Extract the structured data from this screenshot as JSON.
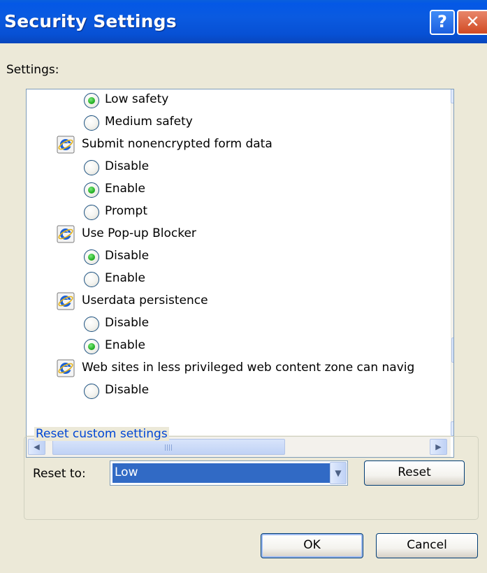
{
  "window": {
    "title": "Security Settings",
    "help_glyph": "?",
    "close_glyph": "✕"
  },
  "settings_label": "Settings:",
  "settings_list": {
    "items": [
      {
        "type": "option",
        "label": "Low safety",
        "checked": true,
        "level": 2
      },
      {
        "type": "option",
        "label": "Medium safety",
        "checked": false,
        "level": 2
      },
      {
        "type": "category",
        "label": "Submit nonencrypted form data",
        "icon": "ie-icon"
      },
      {
        "type": "option",
        "label": "Disable",
        "checked": false,
        "level": 2
      },
      {
        "type": "option",
        "label": "Enable",
        "checked": true,
        "level": 2
      },
      {
        "type": "option",
        "label": "Prompt",
        "checked": false,
        "level": 2
      },
      {
        "type": "category",
        "label": "Use Pop-up Blocker",
        "icon": "ie-icon"
      },
      {
        "type": "option",
        "label": "Disable",
        "checked": true,
        "level": 2
      },
      {
        "type": "option",
        "label": "Enable",
        "checked": false,
        "level": 2
      },
      {
        "type": "category",
        "label": "Userdata persistence",
        "icon": "ie-icon"
      },
      {
        "type": "option",
        "label": "Disable",
        "checked": false,
        "level": 2
      },
      {
        "type": "option",
        "label": "Enable",
        "checked": true,
        "level": 2
      },
      {
        "type": "category",
        "label": "Web sites in less privileged web content zone can navig",
        "icon": "ie-icon"
      },
      {
        "type": "option",
        "label": "Disable",
        "checked": false,
        "level": 2
      }
    ]
  },
  "scrollbars": {
    "up_glyph": "▲",
    "down_glyph": "▼",
    "left_glyph": "◀",
    "right_glyph": "▶"
  },
  "reset_group": {
    "legend": "Reset custom settings",
    "reset_to_label": "Reset to:",
    "reset_to_value": "Low",
    "dropdown_glyph": "▼",
    "reset_button": "Reset"
  },
  "footer": {
    "ok_button": "OK",
    "cancel_button": "Cancel"
  },
  "colors": {
    "titlebar": "#0458e6",
    "selection": "#316ac5",
    "group_legend": "#0046d5",
    "dialog_face": "#ece9d8"
  }
}
